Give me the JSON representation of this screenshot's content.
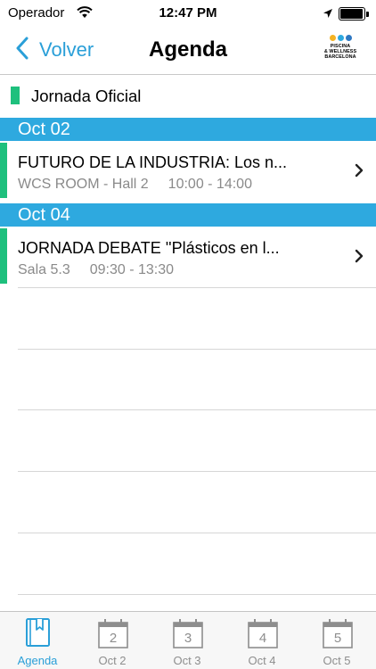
{
  "status_bar": {
    "carrier": "Operador",
    "time": "12:47 PM"
  },
  "nav": {
    "back_label": "Volver",
    "title": "Agenda",
    "logo": {
      "line1": "PISCINA",
      "line2": "& WELLNESS",
      "line3": "BARCELONA",
      "dot_colors": [
        "#f5b323",
        "#2ea9df",
        "#2e78c2"
      ]
    }
  },
  "category": {
    "label": "Jornada Oficial",
    "color": "#1ec07d"
  },
  "sections": [
    {
      "date": "Oct 02",
      "events": [
        {
          "title": "FUTURO DE LA INDUSTRIA: Los n...",
          "room": "WCS ROOM - Hall 2",
          "time": "10:00 - 14:00"
        }
      ]
    },
    {
      "date": "Oct 04",
      "events": [
        {
          "title": "JORNADA DEBATE ''Plásticos en l...",
          "room": "Sala 5.3",
          "time": "09:30 - 13:30"
        }
      ]
    }
  ],
  "tabs": [
    {
      "label": "Agenda",
      "icon": "bookmark-icon",
      "active": true
    },
    {
      "label": "Oct 2",
      "icon": "calendar-icon",
      "number": "2"
    },
    {
      "label": "Oct 3",
      "icon": "calendar-icon",
      "number": "3"
    },
    {
      "label": "Oct 4",
      "icon": "calendar-icon",
      "number": "4"
    },
    {
      "label": "Oct 5",
      "icon": "calendar-icon",
      "number": "5"
    }
  ],
  "colors": {
    "accent": "#2a9fd8",
    "section_header": "#2ea9df",
    "category_green": "#1ec07d",
    "meta_gray": "#8a8a8a"
  }
}
